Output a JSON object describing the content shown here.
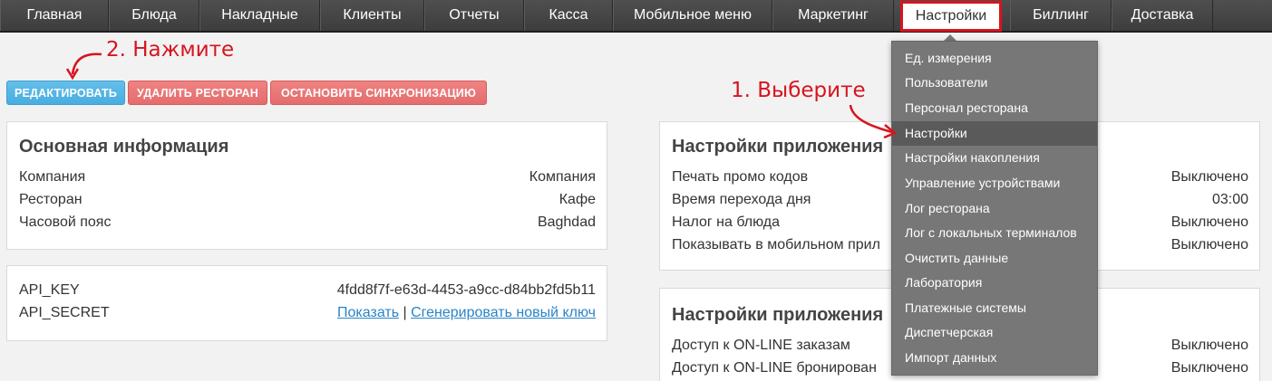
{
  "nav": {
    "items": [
      {
        "label": "Главная"
      },
      {
        "label": "Блюда"
      },
      {
        "label": "Накладные"
      },
      {
        "label": "Клиенты"
      },
      {
        "label": "Отчеты"
      },
      {
        "label": "Касса"
      },
      {
        "label": "Мобильное меню"
      },
      {
        "label": "Маркетинг"
      },
      {
        "label": "Настройки",
        "active": true
      },
      {
        "label": "Биллинг"
      },
      {
        "label": "Доставка"
      }
    ]
  },
  "toolbar": {
    "edit_label": "РЕДАКТИРОВАТЬ",
    "delete_label": "УДАЛИТЬ РЕСТОРАН",
    "stop_sync_label": "ОСТАНОВИТЬ СИНХРОНИЗАЦИЮ"
  },
  "basic_info": {
    "title": "Основная информация",
    "rows": [
      {
        "key": "Компания",
        "value": "Компания"
      },
      {
        "key": "Ресторан",
        "value": "Кафе"
      },
      {
        "key": "Часовой пояс",
        "value": "Baghdad"
      }
    ]
  },
  "api": {
    "rows": [
      {
        "key": "API_KEY",
        "value": "4fdd8f7f-e63d-4453-a9cc-d84bb2fd5b11"
      },
      {
        "key": "API_SECRET",
        "show_link": "Показать",
        "separator": "|",
        "generate_link": "Сгенерировать новый ключ"
      }
    ]
  },
  "app_settings_1": {
    "title": "Настройки приложения",
    "rows": [
      {
        "key": "Печать промо кодов",
        "value": "Выключено"
      },
      {
        "key": "Время перехода дня",
        "value": "03:00"
      },
      {
        "key": "Налог на блюда",
        "value": "Выключено"
      },
      {
        "key": "Показывать в мобильном прил",
        "value": "Выключено"
      }
    ]
  },
  "app_settings_2": {
    "title": "Настройки приложения",
    "rows": [
      {
        "key": "Доступ к ON-LINE заказам",
        "value": "Выключено"
      },
      {
        "key": "Доступ к ON-LINE бронирован",
        "value": "Выключено"
      }
    ]
  },
  "dropdown": {
    "items": [
      {
        "label": "Ед. измерения"
      },
      {
        "label": "Пользователи"
      },
      {
        "label": "Персонал ресторана"
      },
      {
        "label": "Настройки",
        "active": true
      },
      {
        "label": "Настройки накопления"
      },
      {
        "label": "Управление устройствами"
      },
      {
        "label": "Лог ресторана"
      },
      {
        "label": "Лог с локальных терминалов"
      },
      {
        "label": "Очистить данные"
      },
      {
        "label": "Лаборатория"
      },
      {
        "label": "Платежные системы"
      },
      {
        "label": "Диспетчерская"
      },
      {
        "label": "Импорт данных"
      }
    ]
  },
  "annotations": {
    "step1": "1. Выберите",
    "step2": "2. Нажмите"
  },
  "colors": {
    "accent_red": "#d7141f",
    "button_blue": "#48ade0",
    "button_red": "#e46c6c",
    "link_blue": "#2a84c7",
    "nav_bg": "#454545",
    "dropdown_bg": "#777777"
  }
}
